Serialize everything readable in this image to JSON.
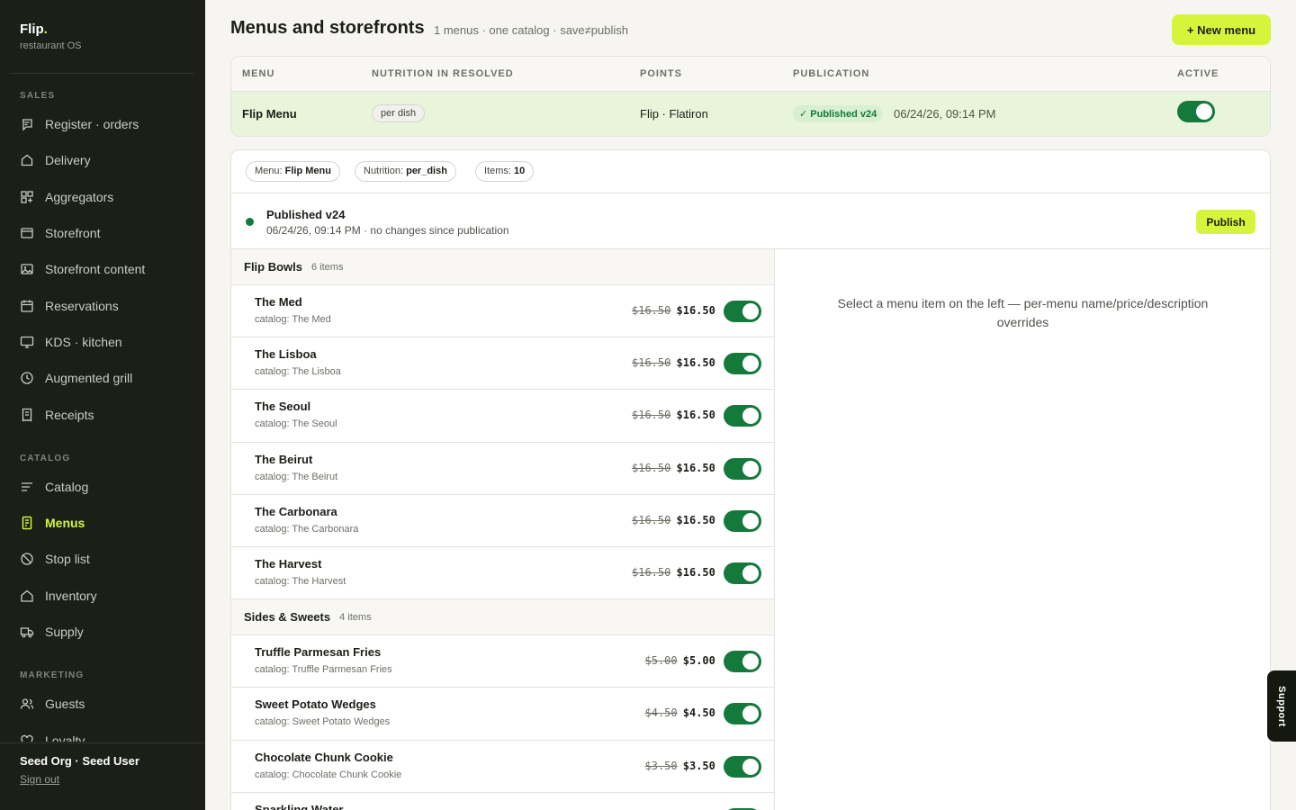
{
  "brand": {
    "name": "Flip",
    "dot": ".",
    "subtitle": "restaurant OS"
  },
  "sidebar": {
    "sections": [
      {
        "label": "SALES",
        "items": [
          {
            "label": "Register · orders",
            "icon": "register-icon"
          },
          {
            "label": "Delivery",
            "icon": "delivery-icon"
          },
          {
            "label": "Aggregators",
            "icon": "aggregators-icon"
          },
          {
            "label": "Storefront",
            "icon": "storefront-icon"
          },
          {
            "label": "Storefront content",
            "icon": "image-icon"
          },
          {
            "label": "Reservations",
            "icon": "calendar-icon"
          },
          {
            "label": "KDS · kitchen",
            "icon": "monitor-icon"
          },
          {
            "label": "Augmented grill",
            "icon": "clock-icon"
          },
          {
            "label": "Receipts",
            "icon": "receipt-icon"
          }
        ]
      },
      {
        "label": "CATALOG",
        "items": [
          {
            "label": "Catalog",
            "icon": "list-icon"
          },
          {
            "label": "Menus",
            "icon": "menu-doc-icon",
            "active": true
          },
          {
            "label": "Stop list",
            "icon": "ban-icon"
          },
          {
            "label": "Inventory",
            "icon": "home-icon"
          },
          {
            "label": "Supply",
            "icon": "truck-icon"
          }
        ]
      },
      {
        "label": "MARKETING",
        "items": [
          {
            "label": "Guests",
            "icon": "users-icon"
          },
          {
            "label": "Loyalty",
            "icon": "heart-icon"
          }
        ]
      }
    ],
    "footer": {
      "user": "Seed Org · Seed User",
      "signout": "Sign out"
    }
  },
  "header": {
    "title": "Menus and storefronts",
    "subtitle": "1 menus · one catalog · save≠publish",
    "new_menu_label": "+ New menu"
  },
  "menus_table": {
    "columns": [
      "MENU",
      "NUTRITION IN RESOLVED",
      "POINTS",
      "PUBLICATION",
      "ACTIVE"
    ],
    "rows": [
      {
        "menu": "Flip Menu",
        "nutrition": "per dish",
        "points": "Flip · Flatiron",
        "publication_badge": "✓ Published v24",
        "publication_date": "06/24/26, 09:14 PM",
        "active": true
      }
    ]
  },
  "detail": {
    "chips": [
      {
        "label": "Menu:",
        "value": "Flip Menu"
      },
      {
        "label": "Nutrition:",
        "value": "per_dish"
      },
      {
        "label": "Items:",
        "value": "10"
      }
    ],
    "status": {
      "title": "Published v24",
      "subtitle": "06/24/26, 09:14 PM · no changes since publication",
      "publish_label": "Publish"
    },
    "groups": [
      {
        "name": "Flip Bowls",
        "count": "6 items",
        "items": [
          {
            "name": "The Med",
            "catalog": "catalog: The Med",
            "old_price": "$16.50",
            "price": "$16.50",
            "enabled": true
          },
          {
            "name": "The Lisboa",
            "catalog": "catalog: The Lisboa",
            "old_price": "$16.50",
            "price": "$16.50",
            "enabled": true
          },
          {
            "name": "The Seoul",
            "catalog": "catalog: The Seoul",
            "old_price": "$16.50",
            "price": "$16.50",
            "enabled": true
          },
          {
            "name": "The Beirut",
            "catalog": "catalog: The Beirut",
            "old_price": "$16.50",
            "price": "$16.50",
            "enabled": true
          },
          {
            "name": "The Carbonara",
            "catalog": "catalog: The Carbonara",
            "old_price": "$16.50",
            "price": "$16.50",
            "enabled": true
          },
          {
            "name": "The Harvest",
            "catalog": "catalog: The Harvest",
            "old_price": "$16.50",
            "price": "$16.50",
            "enabled": true
          }
        ]
      },
      {
        "name": "Sides & Sweets",
        "count": "4 items",
        "items": [
          {
            "name": "Truffle Parmesan Fries",
            "catalog": "catalog: Truffle Parmesan Fries",
            "old_price": "$5.00",
            "price": "$5.00",
            "enabled": true
          },
          {
            "name": "Sweet Potato Wedges",
            "catalog": "catalog: Sweet Potato Wedges",
            "old_price": "$4.50",
            "price": "$4.50",
            "enabled": true
          },
          {
            "name": "Chocolate Chunk Cookie",
            "catalog": "catalog: Chocolate Chunk Cookie",
            "old_price": "$3.50",
            "price": "$3.50",
            "enabled": true
          },
          {
            "name": "Sparkling Water",
            "catalog": "",
            "old_price": "",
            "price": "",
            "enabled": true
          }
        ]
      }
    ],
    "editor_hint": "Select a menu item on the left — per-menu name/price/description overrides"
  },
  "support_label": "Support",
  "colors": {
    "accent": "#d6f53a",
    "sidebar_bg": "#1b1f18",
    "toggle_on": "#137a3b",
    "row_highlight": "#e8f5da"
  }
}
